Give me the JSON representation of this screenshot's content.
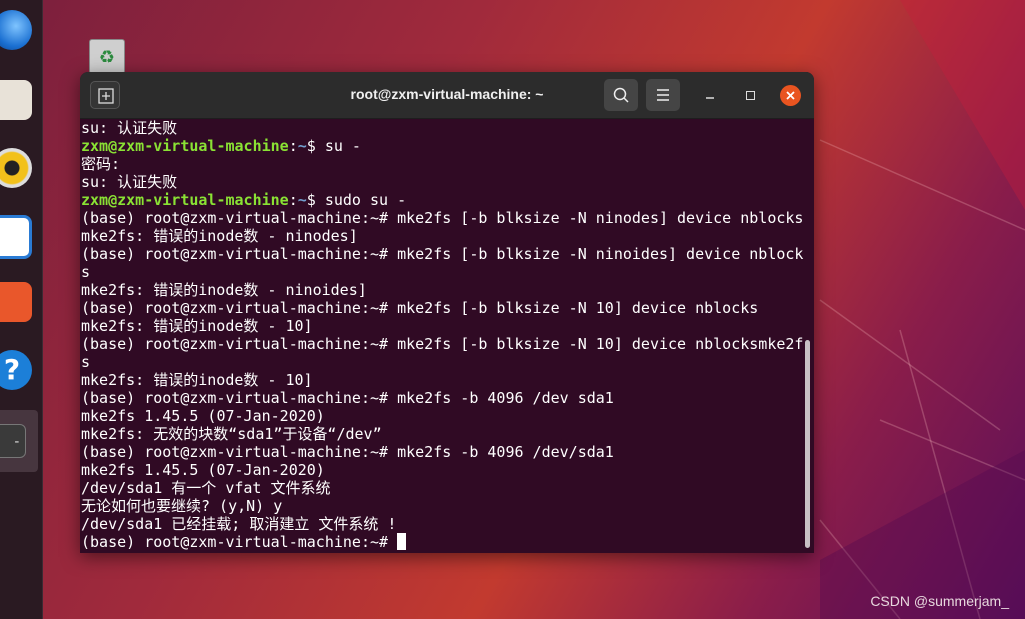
{
  "window": {
    "title": "root@zxm-virtual-machine: ~"
  },
  "terminal": {
    "lines": [
      {
        "type": "text",
        "text": "su: 认证失败"
      },
      {
        "type": "prompt",
        "user": "zxm@zxm-virtual-machine",
        "path": "~",
        "cmd": "$ su -"
      },
      {
        "type": "text",
        "text": "密码:"
      },
      {
        "type": "text",
        "text": "su: 认证失败"
      },
      {
        "type": "prompt",
        "user": "zxm@zxm-virtual-machine",
        "path": "~",
        "cmd": "$ sudo su -"
      },
      {
        "type": "text",
        "text": "(base) root@zxm-virtual-machine:~# mke2fs [-b blksize -N ninodes] device nblocks"
      },
      {
        "type": "text",
        "text": "mke2fs: 错误的inode数 - ninodes]"
      },
      {
        "type": "text",
        "text": "(base) root@zxm-virtual-machine:~# mke2fs [-b blksize -N ninoides] device nblock"
      },
      {
        "type": "text",
        "text": "s"
      },
      {
        "type": "text",
        "text": "mke2fs: 错误的inode数 - ninoides]"
      },
      {
        "type": "text",
        "text": "(base) root@zxm-virtual-machine:~# mke2fs [-b blksize -N 10] device nblocks"
      },
      {
        "type": "text",
        "text": "mke2fs: 错误的inode数 - 10]"
      },
      {
        "type": "text",
        "text": "(base) root@zxm-virtual-machine:~# mke2fs [-b blksize -N 10] device nblocksmke2f"
      },
      {
        "type": "text",
        "text": "s"
      },
      {
        "type": "text",
        "text": "mke2fs: 错误的inode数 - 10]"
      },
      {
        "type": "text",
        "text": "(base) root@zxm-virtual-machine:~# mke2fs -b 4096 /dev sda1"
      },
      {
        "type": "text",
        "text": "mke2fs 1.45.5 (07-Jan-2020)"
      },
      {
        "type": "text",
        "text": "mke2fs: 无效的块数“sda1”于设备“/dev”"
      },
      {
        "type": "text",
        "text": "(base) root@zxm-virtual-machine:~# mke2fs -b 4096 /dev/sda1"
      },
      {
        "type": "text",
        "text": "mke2fs 1.45.5 (07-Jan-2020)"
      },
      {
        "type": "text",
        "text": "/dev/sda1 有一个 vfat 文件系统"
      },
      {
        "type": "text",
        "text": "无论如何也要继续? (y,N) y"
      },
      {
        "type": "text",
        "text": "/dev/sda1 已经挂载; 取消建立 文件系统 !"
      },
      {
        "type": "text",
        "text": "(base) root@zxm-virtual-machine:~# "
      }
    ]
  },
  "dock": {
    "items": [
      "thunderbird-icon",
      "files-icon",
      "rhythmbox-icon",
      "writer-icon",
      "software-icon",
      "help-icon",
      "terminal-icon"
    ]
  },
  "desktop": {
    "watermark": "CSDN @summerjam_"
  }
}
